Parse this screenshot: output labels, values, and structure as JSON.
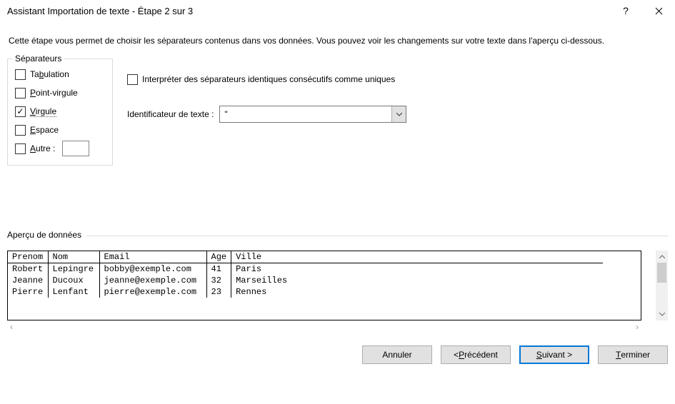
{
  "window": {
    "title": "Assistant Importation de texte - Étape 2 sur 3",
    "help_icon": "?",
    "close_icon": "✕"
  },
  "description": "Cette étape vous permet de choisir les séparateurs contenus dans vos données. Vous pouvez voir les changements sur votre texte dans l'aperçu ci-dessous.",
  "separators": {
    "legend": "Séparateurs",
    "tab": {
      "label_pre": "Ta",
      "label_ul": "b",
      "label_post": "ulation",
      "checked": false
    },
    "semicolon": {
      "label_pre": "",
      "label_ul": "P",
      "label_post": "oint-virgule",
      "checked": false
    },
    "comma": {
      "label_pre": "",
      "label_ul": "V",
      "label_post": "irgule",
      "checked": true
    },
    "space": {
      "label_pre": "",
      "label_ul": "E",
      "label_post": "space",
      "checked": false
    },
    "other": {
      "label_pre": "",
      "label_ul": "A",
      "label_post": "utre :",
      "checked": false,
      "value": ""
    }
  },
  "treat_consecutive": {
    "label": "Interpréter des séparateurs identiques consécutifs comme uniques",
    "checked": false
  },
  "text_qualifier": {
    "label": "Identificateur de texte :",
    "value": "\""
  },
  "preview": {
    "legend": "Aperçu de données",
    "columns": [
      "Prenom",
      "Nom",
      "Email",
      "Age",
      "Ville"
    ],
    "rows": [
      [
        "Robert",
        "Lepingre",
        "bobby@exemple.com",
        "41",
        "Paris"
      ],
      [
        "Jeanne",
        "Ducoux",
        "jeanne@exemple.com",
        "32",
        "Marseilles"
      ],
      [
        "",
        "",
        "",
        "",
        ""
      ],
      [
        "Pierre",
        "Lenfant",
        "pierre@exemple.com",
        "23",
        "Rennes"
      ]
    ]
  },
  "buttons": {
    "cancel": "Annuler",
    "back_pre": "< ",
    "back_ul": "P",
    "back_post": "récédent",
    "next_ul": "S",
    "next_post": "uivant >",
    "finish_ul": "T",
    "finish_post": "erminer"
  }
}
